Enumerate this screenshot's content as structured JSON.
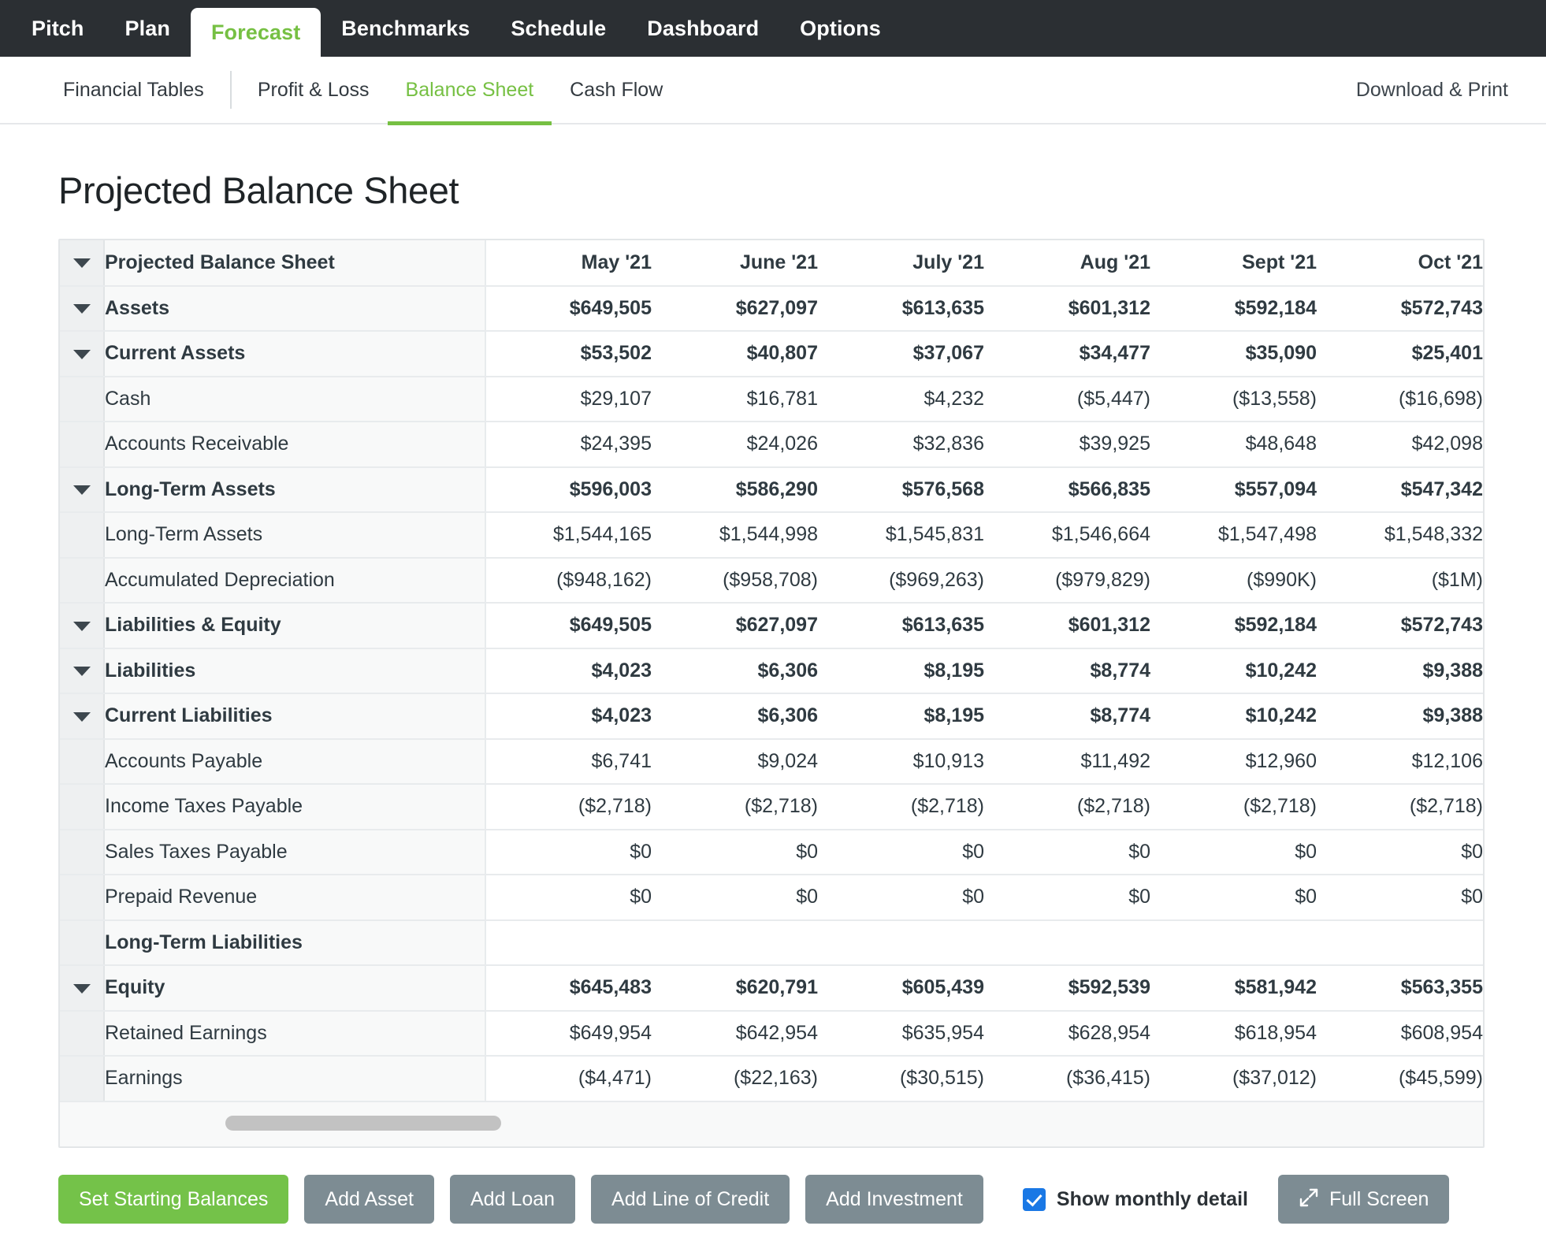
{
  "topnav": {
    "items": [
      {
        "label": "Pitch",
        "active": false
      },
      {
        "label": "Plan",
        "active": false
      },
      {
        "label": "Forecast",
        "active": true
      },
      {
        "label": "Benchmarks",
        "active": false
      },
      {
        "label": "Schedule",
        "active": false
      },
      {
        "label": "Dashboard",
        "active": false
      },
      {
        "label": "Options",
        "active": false
      }
    ],
    "active_color": "#76c043",
    "bar_color": "#2b2f33"
  },
  "subnav": {
    "items": [
      {
        "label": "Financial Tables",
        "active": false
      },
      {
        "label": "Profit & Loss",
        "active": false
      },
      {
        "label": "Balance Sheet",
        "active": true
      },
      {
        "label": "Cash Flow",
        "active": false
      }
    ],
    "download_print": "Download & Print"
  },
  "page": {
    "title": "Projected Balance Sheet"
  },
  "table": {
    "row_header_label": "Projected Balance Sheet",
    "columns": [
      "May '21",
      "June '21",
      "July '21",
      "Aug '21",
      "Sept '21",
      "Oct '21"
    ],
    "rows": [
      {
        "label": "Projected Balance Sheet",
        "indent": 0,
        "bold": true,
        "caret": true,
        "values": [
          "",
          "",
          "",
          "",
          "",
          ""
        ],
        "header": true
      },
      {
        "label": "Assets",
        "indent": 0,
        "bold": true,
        "caret": true,
        "values": [
          "$649,505",
          "$627,097",
          "$613,635",
          "$601,312",
          "$592,184",
          "$572,743"
        ]
      },
      {
        "label": "Current Assets",
        "indent": 1,
        "bold": true,
        "caret": true,
        "values": [
          "$53,502",
          "$40,807",
          "$37,067",
          "$34,477",
          "$35,090",
          "$25,401"
        ]
      },
      {
        "label": "Cash",
        "indent": 2,
        "bold": false,
        "caret": false,
        "values": [
          "$29,107",
          "$16,781",
          "$4,232",
          "($5,447)",
          "($13,558)",
          "($16,698)"
        ]
      },
      {
        "label": "Accounts Receivable",
        "indent": 2,
        "bold": false,
        "caret": false,
        "values": [
          "$24,395",
          "$24,026",
          "$32,836",
          "$39,925",
          "$48,648",
          "$42,098"
        ]
      },
      {
        "label": "Long-Term Assets",
        "indent": 1,
        "bold": true,
        "caret": true,
        "values": [
          "$596,003",
          "$586,290",
          "$576,568",
          "$566,835",
          "$557,094",
          "$547,342"
        ]
      },
      {
        "label": "Long-Term Assets",
        "indent": 2,
        "bold": false,
        "caret": false,
        "values": [
          "$1,544,165",
          "$1,544,998",
          "$1,545,831",
          "$1,546,664",
          "$1,547,498",
          "$1,548,332"
        ]
      },
      {
        "label": "Accumulated Depreciation",
        "indent": 2,
        "bold": false,
        "caret": false,
        "values": [
          "($948,162)",
          "($958,708)",
          "($969,263)",
          "($979,829)",
          "($990K)",
          "($1M)"
        ]
      },
      {
        "label": "Liabilities & Equity",
        "indent": 0,
        "bold": true,
        "caret": true,
        "values": [
          "$649,505",
          "$627,097",
          "$613,635",
          "$601,312",
          "$592,184",
          "$572,743"
        ]
      },
      {
        "label": "Liabilities",
        "indent": 1,
        "bold": true,
        "caret": true,
        "values": [
          "$4,023",
          "$6,306",
          "$8,195",
          "$8,774",
          "$10,242",
          "$9,388"
        ]
      },
      {
        "label": "Current Liabilities",
        "indent": 2,
        "bold": true,
        "caret": true,
        "values": [
          "$4,023",
          "$6,306",
          "$8,195",
          "$8,774",
          "$10,242",
          "$9,388"
        ]
      },
      {
        "label": "Accounts Payable",
        "indent": 3,
        "bold": false,
        "caret": false,
        "values": [
          "$6,741",
          "$9,024",
          "$10,913",
          "$11,492",
          "$12,960",
          "$12,106"
        ]
      },
      {
        "label": "Income Taxes Payable",
        "indent": 3,
        "bold": false,
        "caret": false,
        "values": [
          "($2,718)",
          "($2,718)",
          "($2,718)",
          "($2,718)",
          "($2,718)",
          "($2,718)"
        ]
      },
      {
        "label": "Sales Taxes Payable",
        "indent": 3,
        "bold": false,
        "caret": false,
        "values": [
          "$0",
          "$0",
          "$0",
          "$0",
          "$0",
          "$0"
        ]
      },
      {
        "label": "Prepaid Revenue",
        "indent": 3,
        "bold": false,
        "caret": false,
        "values": [
          "$0",
          "$0",
          "$0",
          "$0",
          "$0",
          "$0"
        ]
      },
      {
        "label": "Long-Term Liabilities",
        "indent": 2,
        "bold": true,
        "caret": false,
        "values": [
          "",
          "",
          "",
          "",
          "",
          ""
        ]
      },
      {
        "label": "Equity",
        "indent": 1,
        "bold": true,
        "caret": true,
        "values": [
          "$645,483",
          "$620,791",
          "$605,439",
          "$592,539",
          "$581,942",
          "$563,355"
        ]
      },
      {
        "label": "Retained Earnings",
        "indent": 2,
        "bold": false,
        "caret": false,
        "values": [
          "$649,954",
          "$642,954",
          "$635,954",
          "$628,954",
          "$618,954",
          "$608,954"
        ]
      },
      {
        "label": "Earnings",
        "indent": 2,
        "bold": false,
        "caret": false,
        "values": [
          "($4,471)",
          "($22,163)",
          "($30,515)",
          "($36,415)",
          "($37,012)",
          "($45,599)"
        ]
      }
    ]
  },
  "footer": {
    "buttons": [
      {
        "label": "Set Starting Balances",
        "style": "green",
        "name": "set-starting-balances-button"
      },
      {
        "label": "Add Asset",
        "style": "grey",
        "name": "add-asset-button"
      },
      {
        "label": "Add Loan",
        "style": "grey",
        "name": "add-loan-button"
      },
      {
        "label": "Add Line of Credit",
        "style": "grey",
        "name": "add-line-of-credit-button"
      },
      {
        "label": "Add Investment",
        "style": "grey",
        "name": "add-investment-button"
      }
    ],
    "checkbox": {
      "label": "Show monthly detail",
      "checked": true,
      "color": "#1a78e5"
    },
    "fullscreen": {
      "label": "Full Screen",
      "icon": "expand-arrows-icon"
    }
  }
}
